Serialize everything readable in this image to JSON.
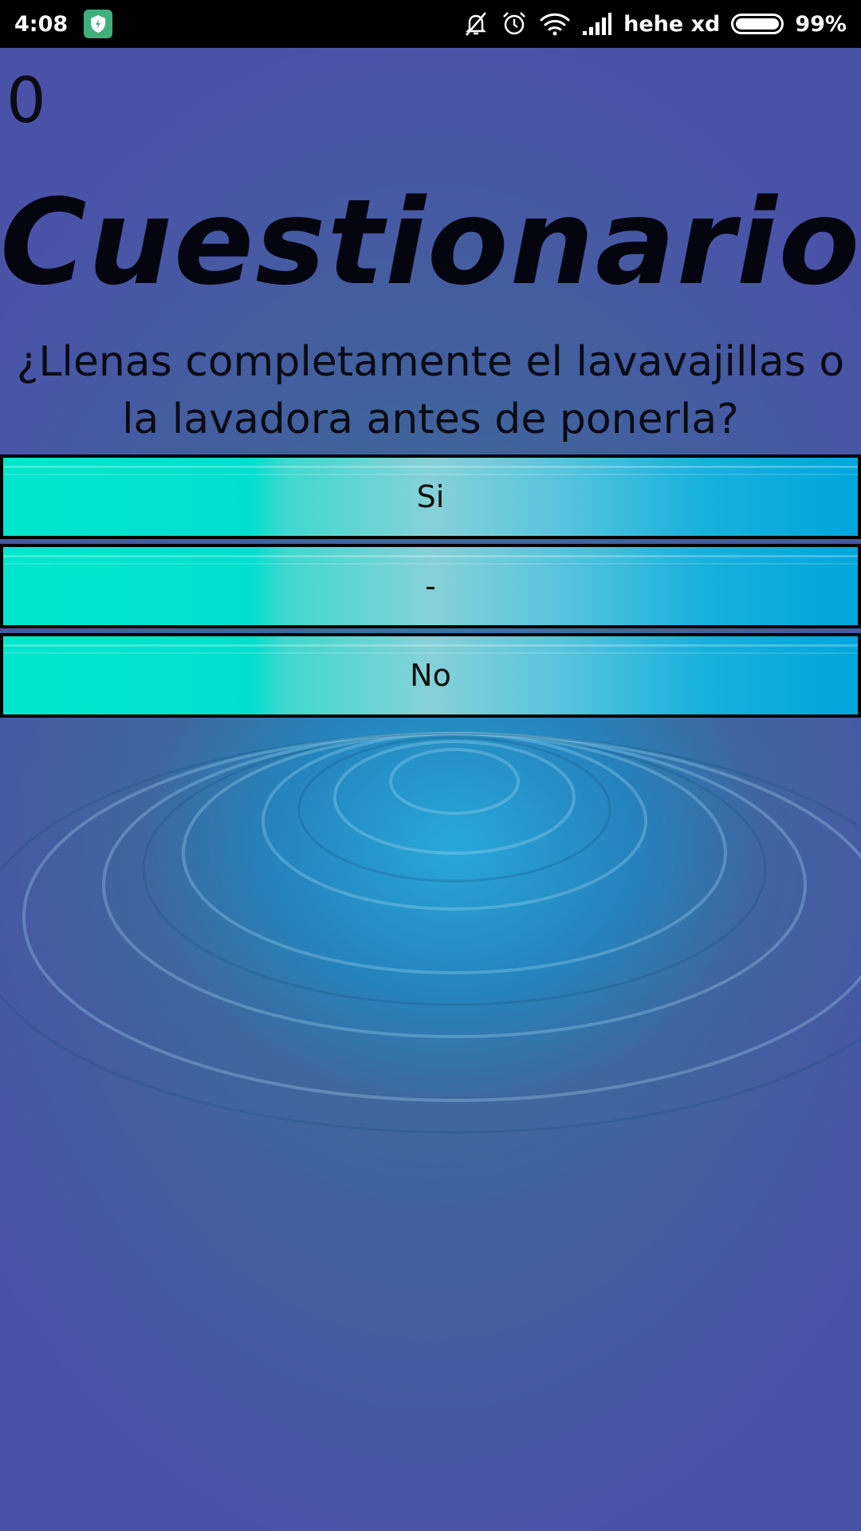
{
  "status_bar": {
    "time": "4:08",
    "carrier": "hehe xd",
    "battery_percent": "99%",
    "battery_level": 0.99,
    "icons": [
      "shield-icon",
      "bell-off-icon",
      "alarm-icon",
      "wifi-icon",
      "signal-icon",
      "battery-icon"
    ]
  },
  "quiz": {
    "score": "0",
    "title": "Cuestionario",
    "question": "¿Llenas completamente el lavavajillas o la lavadora antes de ponerla?",
    "options": [
      {
        "label": "Si"
      },
      {
        "label": "-"
      },
      {
        "label": "No"
      }
    ]
  },
  "colors": {
    "status_bar_bg": "#000000",
    "background": "#4a52a8",
    "button_gradient_start": "#00e6cc",
    "button_gradient_end": "#00a6dc",
    "shield_badge": "#3fb07c"
  }
}
